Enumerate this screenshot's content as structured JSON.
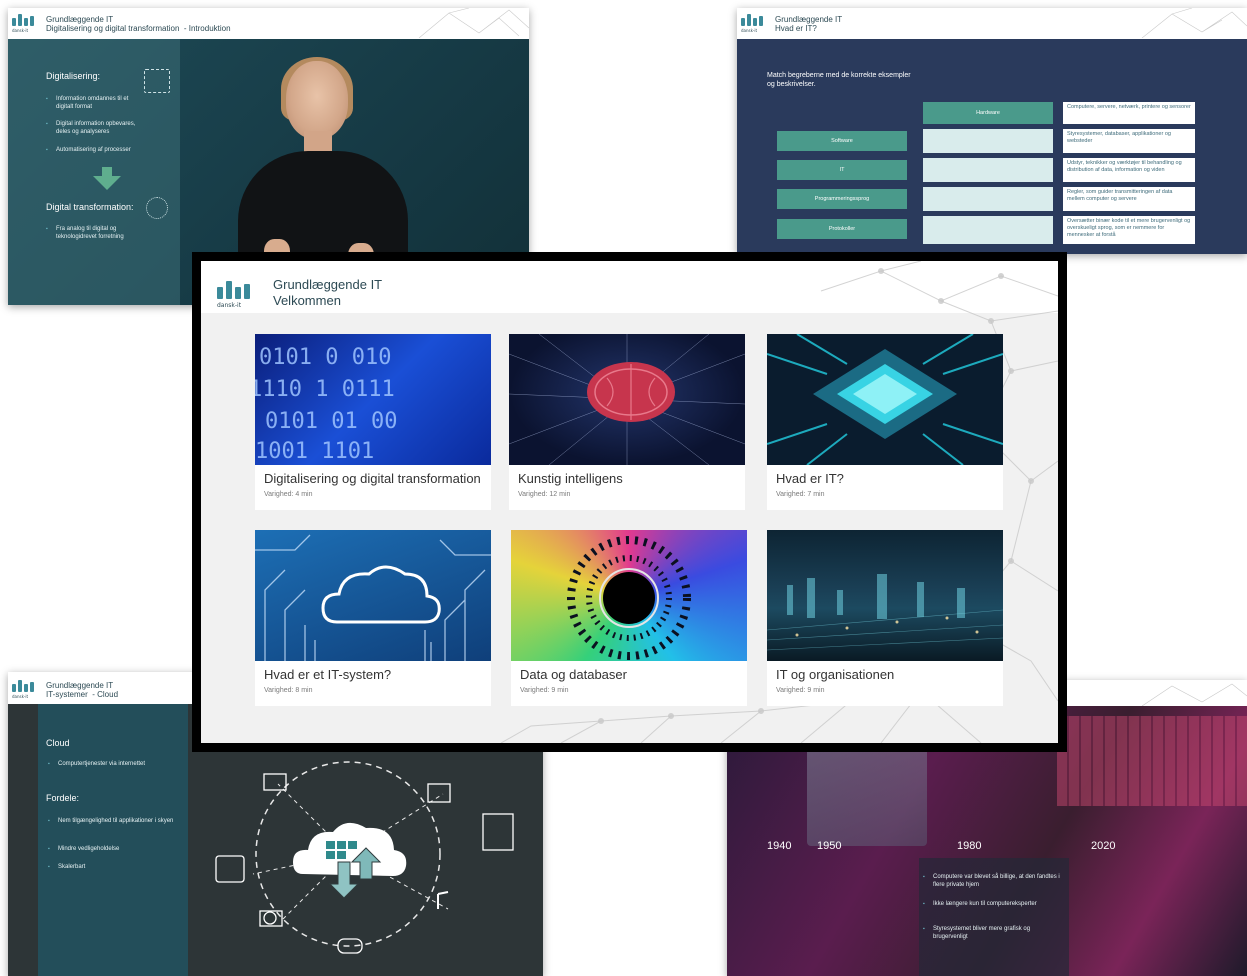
{
  "brand": {
    "logo_tag": "dansk-it",
    "course": "Grundlæggende IT",
    "accent": "#3b8a9a"
  },
  "slide_top_left": {
    "subtitle": "Digitalisering og digital transformation",
    "chapter": "- Introduktion",
    "heading1": "Digitalisering:",
    "bullets1": [
      "Information omdannes til et digitalt format",
      "Digital information opbevares, deles og analyseres",
      "Automatisering af processer"
    ],
    "heading2": "Digital transformation:",
    "bullets2": [
      "Fra analog til digital og teknologidrevet forretning"
    ]
  },
  "slide_top_right": {
    "subtitle": "Hvad er IT?",
    "instruction": "Match begreberne med de korrekte eksempler og beskrivelser.",
    "placed": "Hardware",
    "terms": [
      "Software",
      "IT",
      "Programmeringssprog",
      "Protokoller"
    ],
    "descriptions": [
      "Computere, servere, netværk, printere og sensorer",
      "Styresystemer, databaser, applikationer og websteder",
      "Udstyr, teknikker og værktøjer til behandling og distribution af data, information og viden",
      "Regler, som guider transmitteringen af data mellem computer og servere",
      "Oversætter binær kode til et mere brugervenligt og overskueligt sprog, som er nemmere for mennesker at forstå"
    ]
  },
  "slide_main": {
    "subtitle": "Velkommen",
    "cards": [
      {
        "title": "Digitalisering og digital transformation",
        "duration": "Varighed: 4 min"
      },
      {
        "title": "Kunstig intelligens",
        "duration": "Varighed: 12 min"
      },
      {
        "title": "Hvad er IT?",
        "duration": "Varighed: 7 min"
      },
      {
        "title": "Hvad er et IT-system?",
        "duration": "Varighed: 8 min"
      },
      {
        "title": "Data og databaser",
        "duration": "Varighed: 9 min"
      },
      {
        "title": "IT og organisationen",
        "duration": "Varighed: 9 min"
      }
    ]
  },
  "slide_bottom_left": {
    "subtitle": "IT-systemer",
    "chapter": "- Cloud",
    "heading1": "Cloud",
    "bullets1": [
      "Computertjenester via internettet"
    ],
    "heading2": "Fordele:",
    "bullets2": [
      "Nem tilgængelighed til applikationer i skyen",
      "Mindre vedligeholdelse",
      "Skalerbart"
    ]
  },
  "slide_bottom_right": {
    "years": [
      "1940",
      "1950",
      "1980",
      "2020"
    ],
    "bullets": [
      "Computere var blevet så billige, at den fandtes i flere private hjem",
      "Ikke længere kun til computereksperter",
      "Styresystemet bliver mere grafisk og brugervenligt"
    ]
  }
}
